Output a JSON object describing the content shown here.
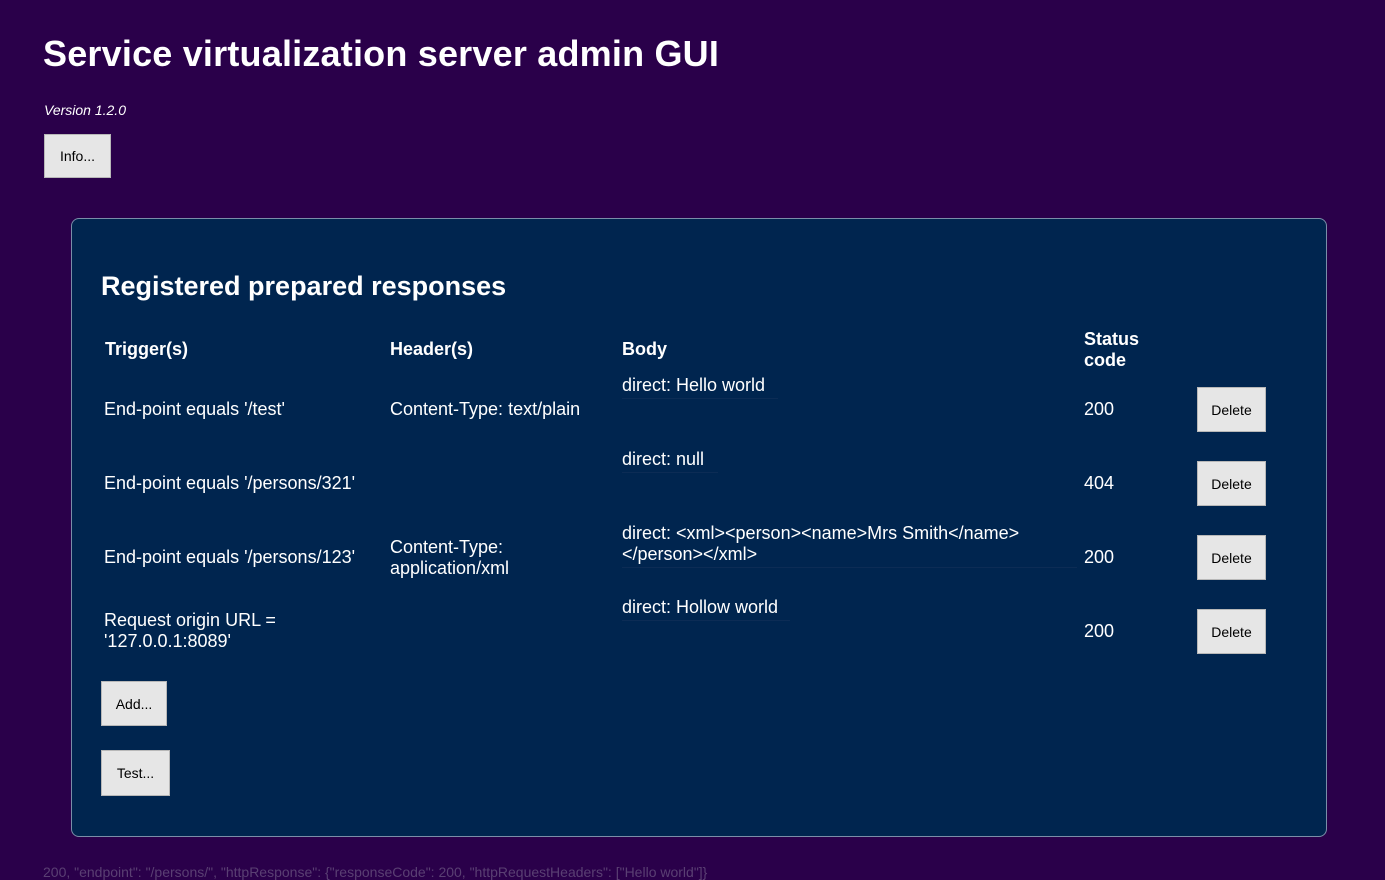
{
  "header": {
    "title": "Service virtualization server admin GUI",
    "version": "Version 1.2.0",
    "info_button": "Info..."
  },
  "panel": {
    "title": "Registered prepared responses",
    "columns": {
      "triggers": "Trigger(s)",
      "headers": "Header(s)",
      "body": "Body",
      "status": "Status code"
    },
    "rows": [
      {
        "trigger": "End-point equals '/test'",
        "header": "Content-Type: text/plain",
        "body": "direct: Hello world",
        "status": "200",
        "delete": "Delete"
      },
      {
        "trigger": "End-point equals '/persons/321'",
        "header": "",
        "body": "direct: null",
        "status": "404",
        "delete": "Delete"
      },
      {
        "trigger": "End-point equals '/persons/123'",
        "header": "Content-Type: application/xml",
        "body": "direct: <xml><person><name>Mrs Smith</name></person></xml>",
        "status": "200",
        "delete": "Delete"
      },
      {
        "trigger": "Request origin URL = '127.0.0.1:8089'",
        "header": "",
        "body": "direct: Hollow world",
        "status": "200",
        "delete": "Delete"
      }
    ],
    "add_button": "Add...",
    "test_button": "Test..."
  },
  "footer": {
    "text": "200, \"endpoint\": \"/persons/\", \"httpResponse\": {\"responseCode\": 200, \"httpRequestHeaders\": [\"Hello world\"]}"
  }
}
